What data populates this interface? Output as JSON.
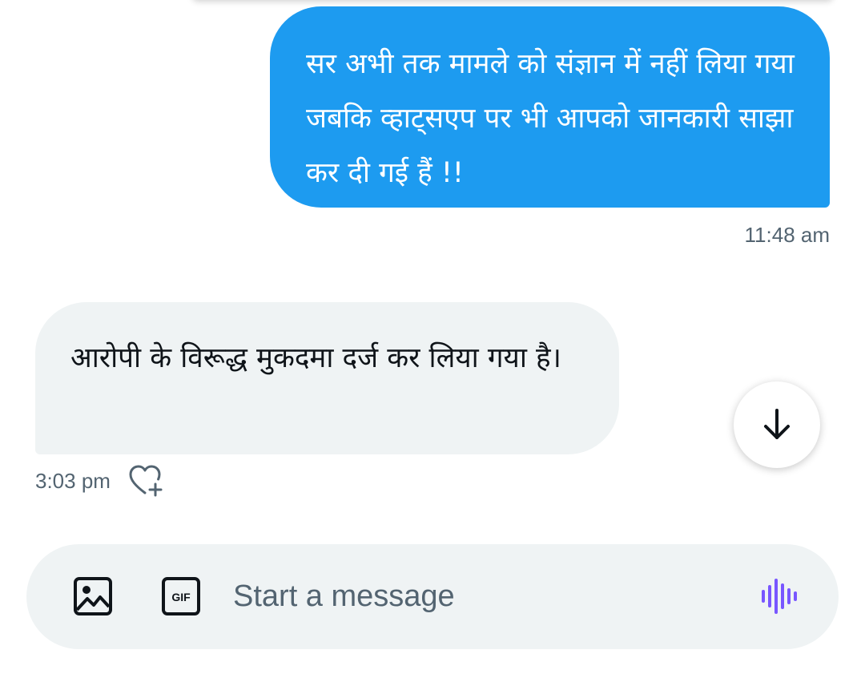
{
  "messages": [
    {
      "direction": "sent",
      "text": "सर अभी तक मामले को संज्ञान में नहीं लिया गया जबकि व्हाट्सएप पर भी आपको जानकारी साझा कर दी गई हैं !!",
      "time": "11:48 am"
    },
    {
      "direction": "received",
      "text": "आरोपी के विरूद्ध मुकदमा दर्ज कर लिया गया है।",
      "time": "3:03 pm"
    }
  ],
  "composer": {
    "placeholder": "Start a message",
    "media_icon": "image-icon",
    "gif_icon": "gif-icon",
    "voice_icon": "voice-message-icon"
  },
  "icons": {
    "react": "heart-plus-icon",
    "scroll_down": "arrow-down-icon"
  },
  "colors": {
    "sent_bubble": "#1d9bf0",
    "received_bubble": "#eff3f4",
    "timestamp": "#536471",
    "voice_accent": "#7856ff"
  }
}
